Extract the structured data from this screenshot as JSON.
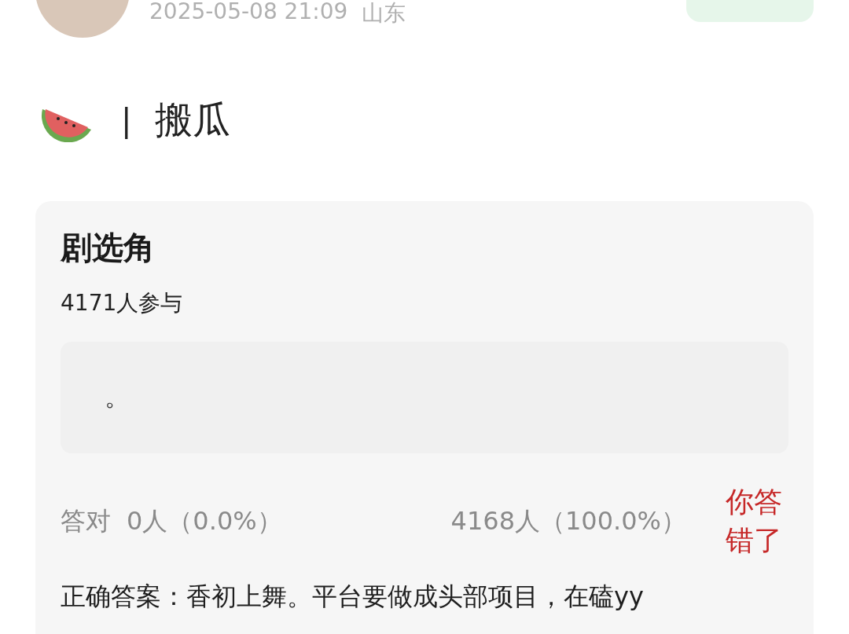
{
  "post": {
    "timestamp": "2025-05-08 21:09",
    "location": "山东"
  },
  "post_title": {
    "separator": "|",
    "text": "搬瓜"
  },
  "quiz": {
    "title": "剧选角",
    "participants": "4171人参与",
    "option": {
      "text": "。"
    },
    "result": {
      "correct_label": "答对",
      "correct_count": "0人（0.0%）",
      "other_count": "4168人（100.0%）",
      "verdict": "你答错了",
      "wrong": true
    },
    "answer": "正确答案：香初上舞。平台要做成头部项目，在磕yy"
  }
}
